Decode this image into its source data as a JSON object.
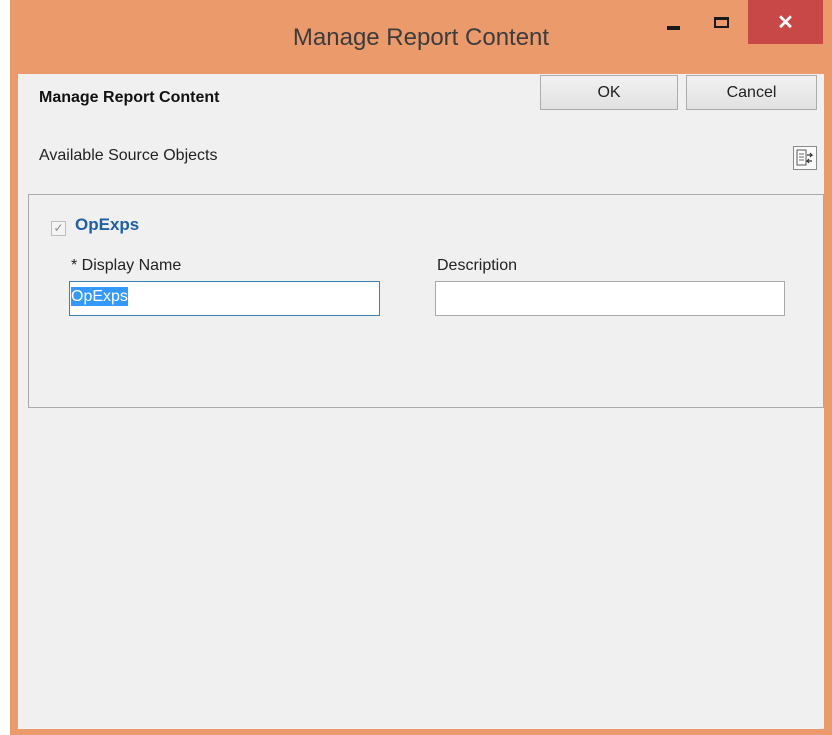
{
  "window": {
    "title": "Manage Report Content",
    "minimize": "minimize",
    "maximize": "maximize",
    "close": "✕"
  },
  "header": {
    "title": "Manage Report Content",
    "ok_label": "OK",
    "cancel_label": "Cancel"
  },
  "section": {
    "label": "Available Source Objects",
    "tool_icon": "swap-columns-icon"
  },
  "object": {
    "checked": true,
    "check_glyph": "✓",
    "name": "OpExps",
    "display_name_label": "* Display Name",
    "display_name_value": "OpExps",
    "description_label": "Description",
    "description_value": ""
  },
  "colors": {
    "title_bar": "#eb9a6c",
    "close_button": "#c74846",
    "object_name": "#1f5fa8",
    "selection": "#3399ff"
  }
}
